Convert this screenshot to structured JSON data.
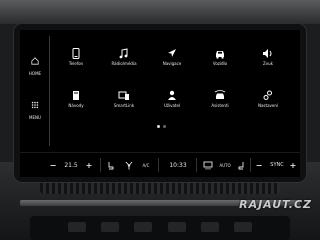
{
  "side": {
    "home_label": "HOME",
    "menu_label": "MENU"
  },
  "apps": [
    {
      "label": "Telefon",
      "icon": "phone-icon"
    },
    {
      "label": "Rádio/média",
      "icon": "music-note-icon"
    },
    {
      "label": "Navigace",
      "icon": "navigation-arrow-icon"
    },
    {
      "label": "Vozidlo",
      "icon": "car-icon"
    },
    {
      "label": "Zvuk",
      "icon": "speaker-icon"
    },
    {
      "label": "Návody",
      "icon": "book-icon"
    },
    {
      "label": "SmartLink",
      "icon": "smartlink-icon"
    },
    {
      "label": "Uživatel",
      "icon": "user-icon"
    },
    {
      "label": "Asistenti",
      "icon": "assist-car-icon"
    },
    {
      "label": "Nastavení",
      "icon": "settings-icon"
    }
  ],
  "pager": {
    "pages": 2,
    "active": 1
  },
  "climate": {
    "left_temp": "21.5",
    "minus": "−",
    "plus": "+",
    "ac_label": "A/C",
    "auto_label": "AUTO",
    "time": "10:33",
    "right_minus": "−",
    "right_plus": "+",
    "sync_label": "SYNC"
  },
  "watermark": "RAJAUT.CZ",
  "colors": {
    "accent": "#e4002b",
    "screen_bg": "#000000"
  }
}
